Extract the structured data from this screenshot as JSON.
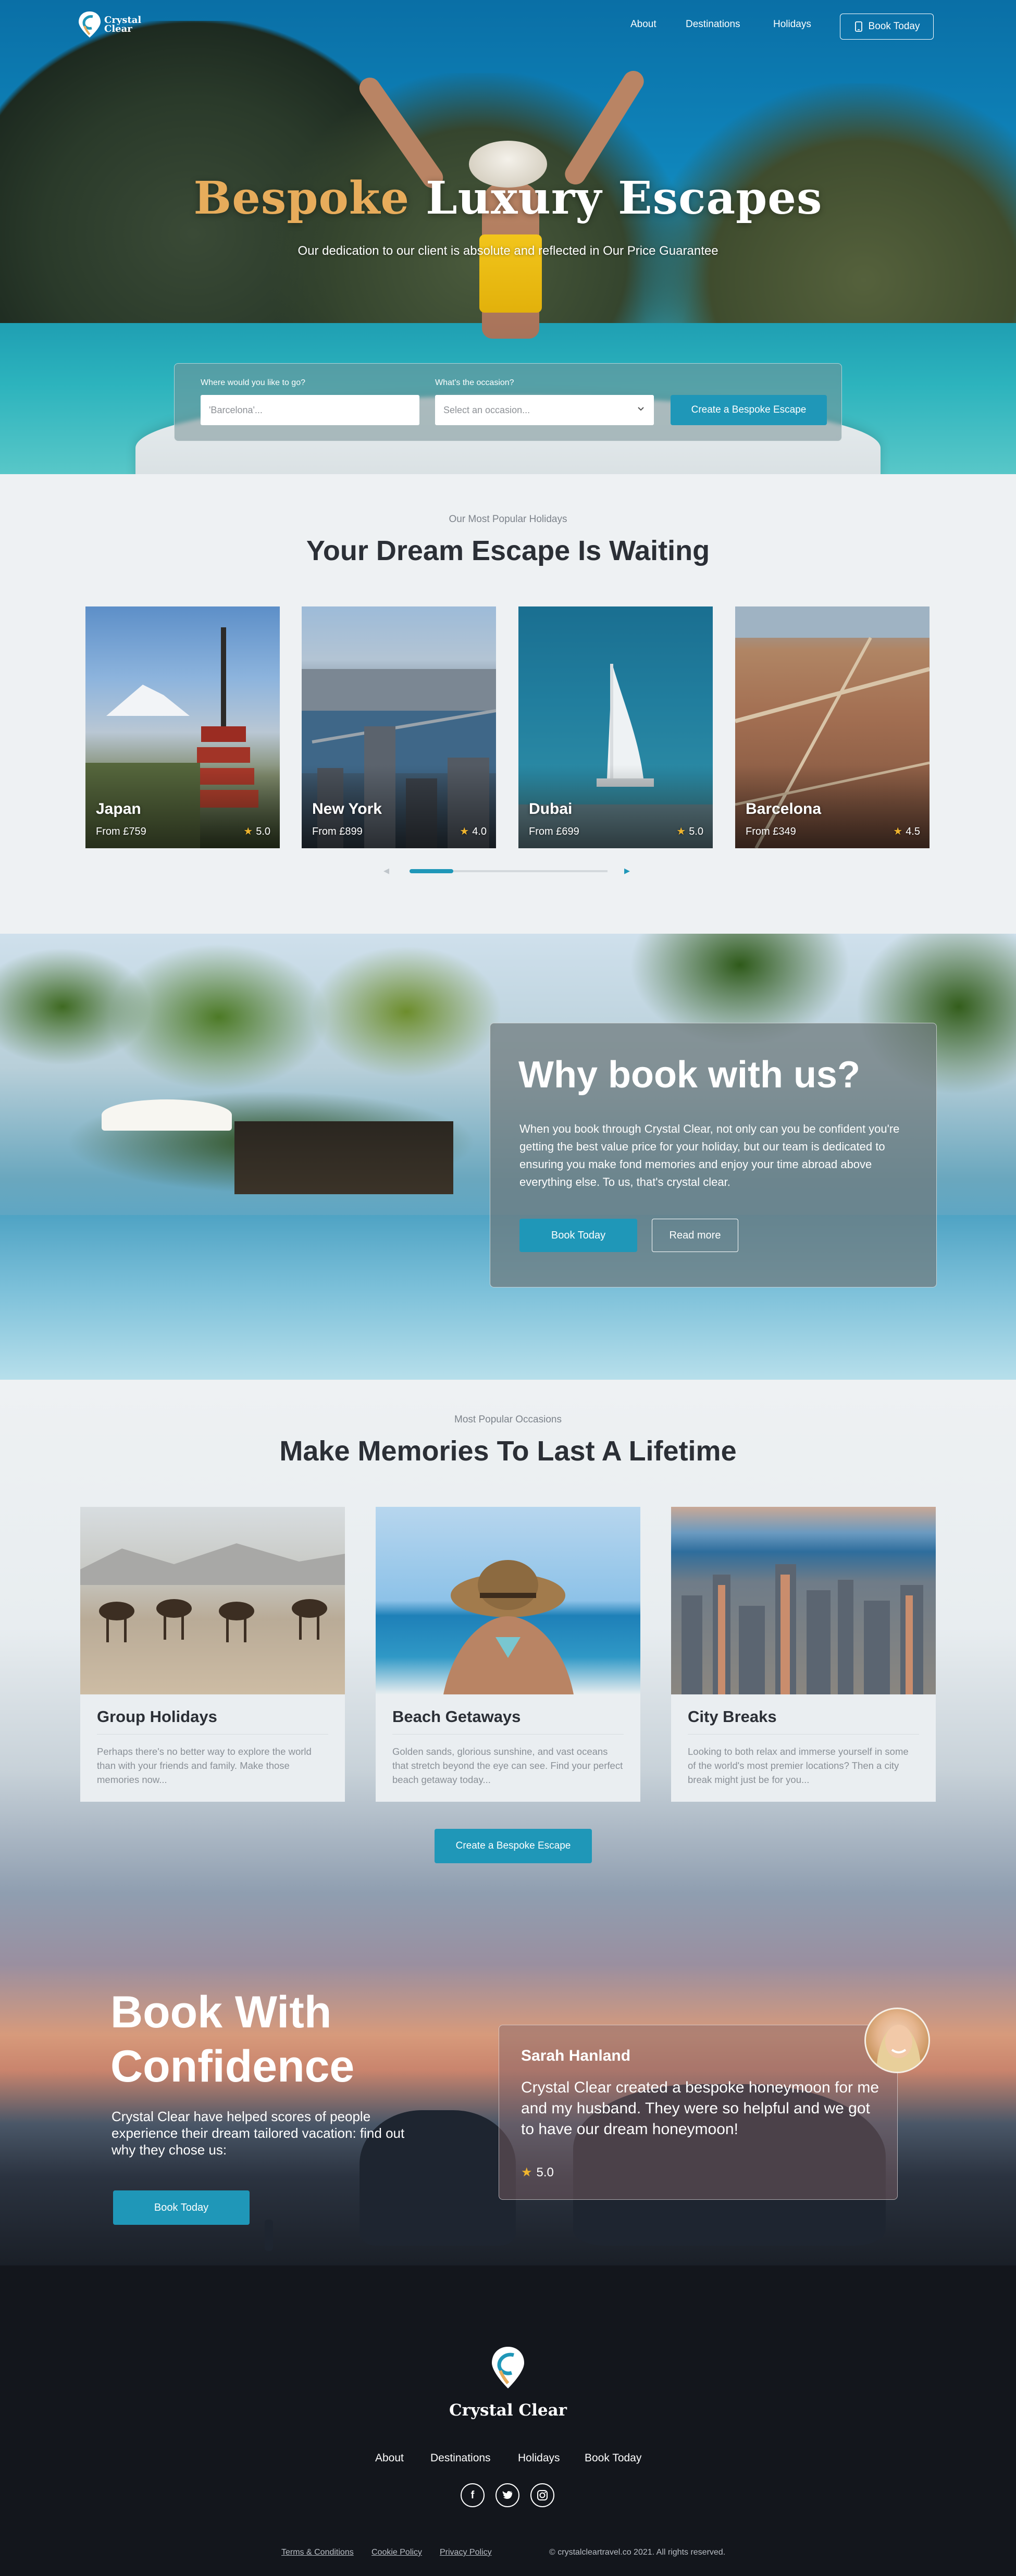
{
  "brand": {
    "name_line1": "Crystal",
    "name_line2": "Clear",
    "footer_name": "Crystal Clear"
  },
  "nav": {
    "items": [
      "About",
      "Destinations",
      "Holidays"
    ],
    "book_label": "Book Today"
  },
  "hero": {
    "title_accent": "Bespoke",
    "title_rest": "Luxury Escapes",
    "subtitle": "Our dedication to our client is absolute and reflected in Our Price Guarantee"
  },
  "search": {
    "where_label": "Where would you like to go?",
    "where_placeholder": "'Barcelona'...",
    "occasion_label": "What's the occasion?",
    "occasion_placeholder": "Select an occasion...",
    "cta": "Create a Bespoke Escape"
  },
  "popular": {
    "eyebrow": "Our Most Popular Holidays",
    "title": "Your Dream Escape Is Waiting",
    "slider_progress": 0.22,
    "destinations": [
      {
        "name": "Japan",
        "price": "From £759",
        "rating": "5.0"
      },
      {
        "name": "New York",
        "price": "From £899",
        "rating": "4.0"
      },
      {
        "name": "Dubai",
        "price": "From £699",
        "rating": "5.0"
      },
      {
        "name": "Barcelona",
        "price": "From £349",
        "rating": "4.5"
      }
    ]
  },
  "why": {
    "title": "Why book with us?",
    "body": "When you book through Crystal Clear, not only can you be confident you're getting the best value price for your holiday, but our team is dedicated to ensuring you make fond memories and enjoy your time abroad above everything else. To us, that's crystal clear.",
    "primary": "Book Today",
    "secondary": "Read more"
  },
  "occasions": {
    "eyebrow": "Most Popular Occasions",
    "title": "Make Memories To Last A Lifetime",
    "items": [
      {
        "title": "Group Holidays",
        "desc": "Perhaps there's no better way to explore the world than with your friends and family. Make those memories now..."
      },
      {
        "title": "Beach Getaways",
        "desc": "Golden sands, glorious sunshine, and vast oceans that stretch beyond the eye can see. Find your perfect beach getaway today..."
      },
      {
        "title": "City Breaks",
        "desc": "Looking to both relax and immerse yourself in some of the world's most premier locations? Then a city break might just be for you..."
      }
    ],
    "cta": "Create a Bespoke Escape"
  },
  "confidence": {
    "title_line1": "Book With",
    "title_line2": "Confidence",
    "subtitle": "Crystal Clear have helped scores of people experience their dream tailored vacation: find out why they chose us:",
    "cta": "Book Today",
    "review": {
      "name": "Sarah Hanland",
      "quote": "Crystal Clear created a bespoke honeymoon for me and my husband. They were so helpful and we got to have our dream honeymoon!",
      "rating": "5.0"
    }
  },
  "footer": {
    "nav": [
      "About",
      "Destinations",
      "Holidays",
      "Book Today"
    ],
    "social": [
      "facebook-icon",
      "twitter-icon",
      "instagram-icon"
    ],
    "legal": [
      "Terms & Conditions",
      "Cookie Policy",
      "Privacy Policy"
    ],
    "copyright": "© crystalcleartravel.co 2021. All rights reserved."
  },
  "colors": {
    "accent": "#1f97b8",
    "gold": "#e7ac5b",
    "star": "#f0b52e",
    "footer_bg": "#13161c"
  }
}
